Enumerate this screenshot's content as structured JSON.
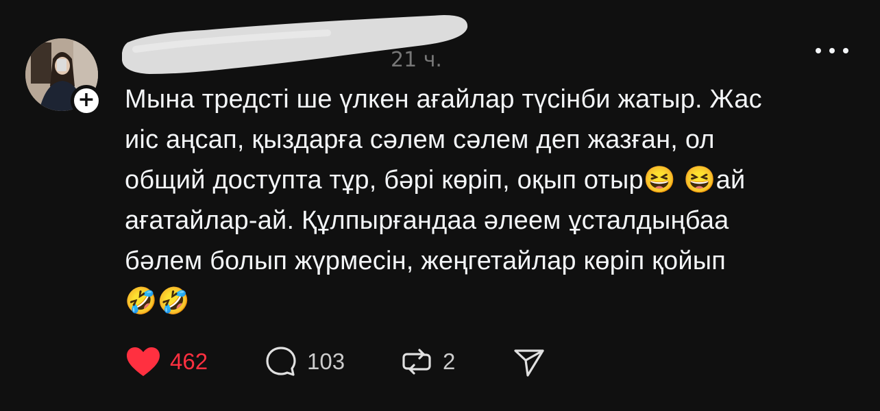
{
  "post": {
    "username": "",
    "timestamp": "21 ч.",
    "text_lines": [
      "Мына тредсті ше үлкен ағайлар түсінби жатыр. Жас",
      "иіс аңсап, қыздарға сәлем сәлем деп жазған, ол",
      "общий доступта тұр, бәрі көріп, оқып отыр😆 😆ай",
      "ағатайлар-ай. Құлпырғандаа әлеем ұсталдыңбаа",
      "бәлем болып жүрмесін, жеңгетайлар көріп қойып",
      "🤣🤣"
    ],
    "follow_label": "+",
    "icons": {
      "more": "more-horizontal-icon",
      "like": "heart-icon",
      "comment": "comment-bubble-icon",
      "repost": "repost-icon",
      "share": "share-send-icon"
    }
  },
  "actions": {
    "likes": "462",
    "comments": "103",
    "reposts": "2"
  },
  "colors": {
    "background": "#101010",
    "text": "#f3f5f7",
    "muted": "#777777",
    "like_red": "#ff3040"
  }
}
